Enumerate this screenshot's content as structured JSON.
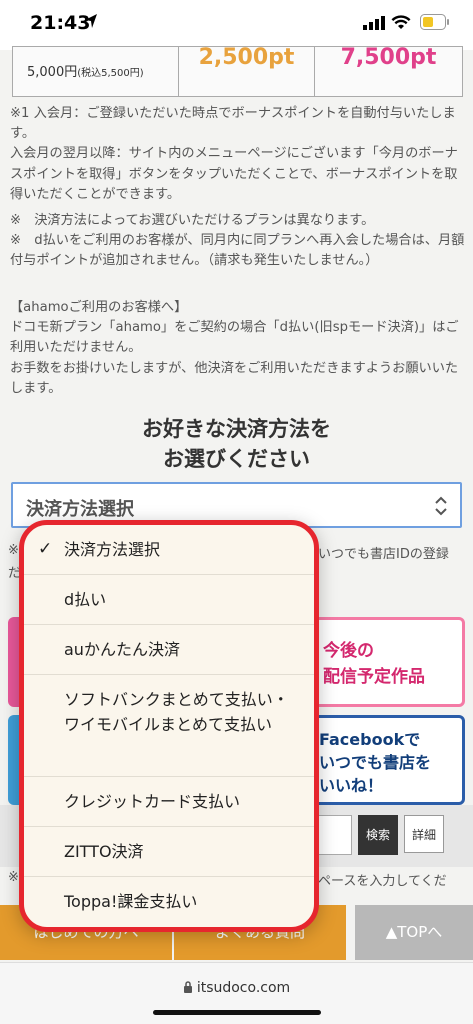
{
  "status": {
    "time": "21:43"
  },
  "price_table": {
    "price": "5,000円",
    "price_tax": "(税込5,500円)",
    "pt1": "2,500pt",
    "pt2": "7,500pt"
  },
  "notes": {
    "n1": "※1 入会月：ご登録いただいた時点でボーナスポイントを自動付与いたします。\n入会月の翌月以降：サイト内のメニューページにございます「今月のボーナスポイントを取得」ボタンをタップいただくことで、ボーナスポイントを取得いただくことができます。",
    "n2": "※　決済方法によってお選びいただけるプランは異なります。\n※　d払いをご利用のお客様が、同月内に同プランへ再入会した場合は、月額付与ポイントが追加されません。（請求も発生いたしません。）",
    "n3": "【ahamoご利用のお客様へ】\nドコモ新プラン「ahamo」をご契約の場合「d払い(旧spモード決済)」はご利用いただけません。\nお手数をお掛けいたしますが、他決済をご利用いただきますようお願いいたします。"
  },
  "heading": {
    "line1": "お好きな決済方法を",
    "line2": "お選びください"
  },
  "select": {
    "value": "決済方法選択"
  },
  "background": {
    "note_left": "※",
    "note_right": "いつでも書店IDの登録",
    "note_left2": "だ",
    "pink_banner": "今後の\n配信予定作品",
    "blue_banner": "Facebookで\nいつでも書店を\nいいね！",
    "search_button": "検索",
    "detail_button": "詳細",
    "search_note_left": "※",
    "search_note_right": "ペースを入力してくだ",
    "footer_left": "はじめての方へ",
    "footer_mid": "よくある質問",
    "footer_right": "▲TOPへ"
  },
  "dropdown": {
    "options": [
      {
        "label": "決済方法選択",
        "selected": true
      },
      {
        "label": "d払い",
        "selected": false
      },
      {
        "label": "auかんたん決済",
        "selected": false
      },
      {
        "label": "ソフトバンクまとめて支払い・ワイモバイルまとめて支払い",
        "selected": false
      },
      {
        "label": "クレジットカード支払い",
        "selected": false
      },
      {
        "label": "ZITTO決済",
        "selected": false
      },
      {
        "label": "Toppa!課金支払い",
        "selected": false
      }
    ],
    "check": "✓"
  },
  "address_bar": {
    "url": "itsudoco.com"
  },
  "colors": {
    "highlight": "#e6262e",
    "select_border": "#6f9fe0",
    "footer_btn": "#e39a2c"
  }
}
